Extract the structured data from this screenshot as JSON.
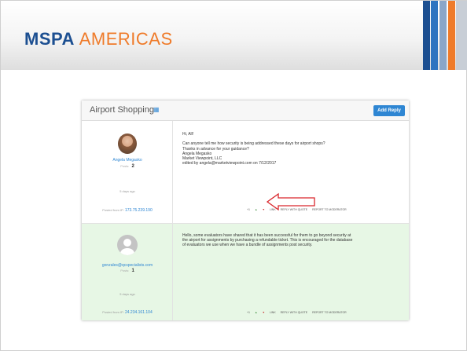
{
  "header": {
    "brand_primary": "MSPA",
    "brand_secondary": "AMERICAS",
    "colors": {
      "brand_blue": "#1c4f91",
      "brand_orange": "#ef7b2a",
      "stripe_1": "#1c4f91",
      "stripe_2": "#2e74c0",
      "stripe_3": "#8aa6c8",
      "stripe_4": "#ef7b2a"
    }
  },
  "topic": {
    "title": "Airport Shopping",
    "feed_icon": "rss-icon",
    "add_reply_label": "Add Reply",
    "accent": "#2e86d3"
  },
  "posts": [
    {
      "author": "Angela Megasko",
      "posts_label": "Posts:",
      "posts_count": "2",
      "time_ago": "5 days ago",
      "posted_from_label": "Posted from IP:",
      "ip": "173.75.239.190",
      "avatar": "profile-photo",
      "lines": [
        "Hi, All!",
        "",
        "Can anyone tell me how security is being addressed these days for airport shops?",
        "Thanks in advance for your guidance?",
        "Angela Megasko",
        "Market Viewpoint, LLC",
        "edited by angela@marketviewpoint.com on 7/12/2017"
      ],
      "actions": [
        "+1",
        "Like",
        "Dislike",
        "LINK",
        "REPLY WITH QUOTE",
        "REPORT TO MODERATOR"
      ],
      "background": "#ffffff"
    },
    {
      "author": "gonzales@qcspecialists.com",
      "posts_label": "Posts:",
      "posts_count": "1",
      "time_ago": "5 days ago",
      "posted_from_label": "Posted from IP:",
      "ip": "24.234.161.104",
      "avatar": "default-user",
      "lines": [
        "Hello, some evaluators have shared that it has been successful for them to go beyond security at",
        "the airport for assignments by purchasing a refundable ticket. This is encouraged for the database",
        "of evaluators we use when we have a bundle of assignments post security."
      ],
      "actions": [
        "+1",
        "Like",
        "Dislike",
        "LINK",
        "REPLY WITH QUOTE",
        "REPORT TO MODERATOR"
      ],
      "background": "#e7f7e5"
    }
  ],
  "annotation": {
    "type": "arrow",
    "points_to": "REPORT TO MODERATOR",
    "color": "#d9262c"
  }
}
